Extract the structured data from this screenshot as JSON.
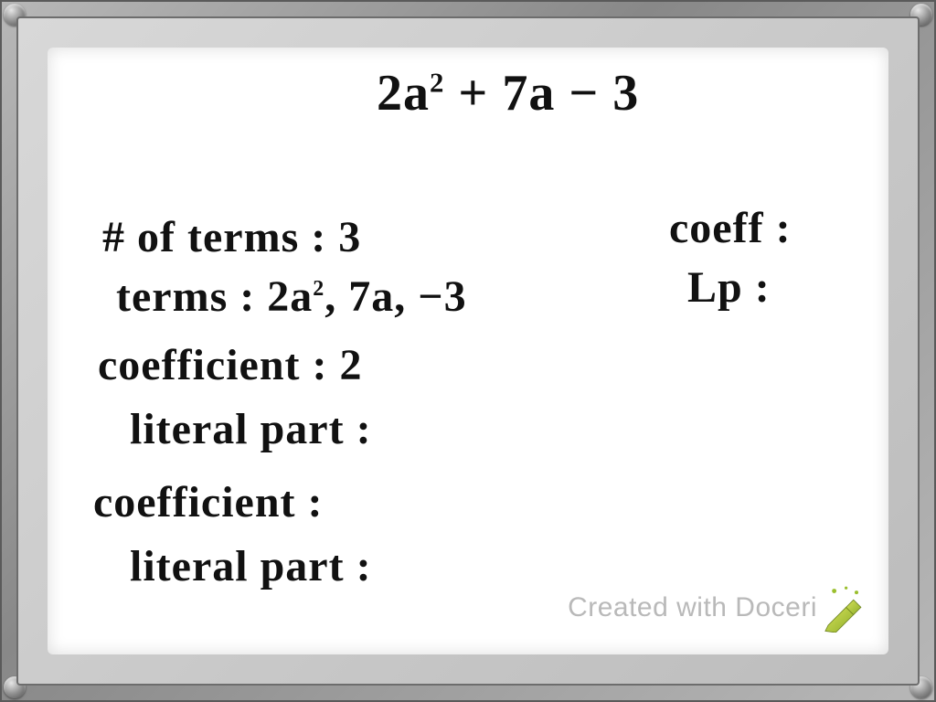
{
  "whiteboard": {
    "expression_html": "2a<sup>2</sup> + 7a − 3",
    "lines": {
      "num_terms": "# of terms : 3",
      "terms_html": "terms : 2a<sup>2</sup>, 7a, −3",
      "coeff_a": "coefficient : 2",
      "lit_a": "literal part :",
      "coeff_b": "coefficient :",
      "lit_b": "literal part :",
      "right_coeff": "coeff :",
      "right_lp": "Lp :"
    }
  },
  "watermark": {
    "text": "Created with Doceri"
  }
}
